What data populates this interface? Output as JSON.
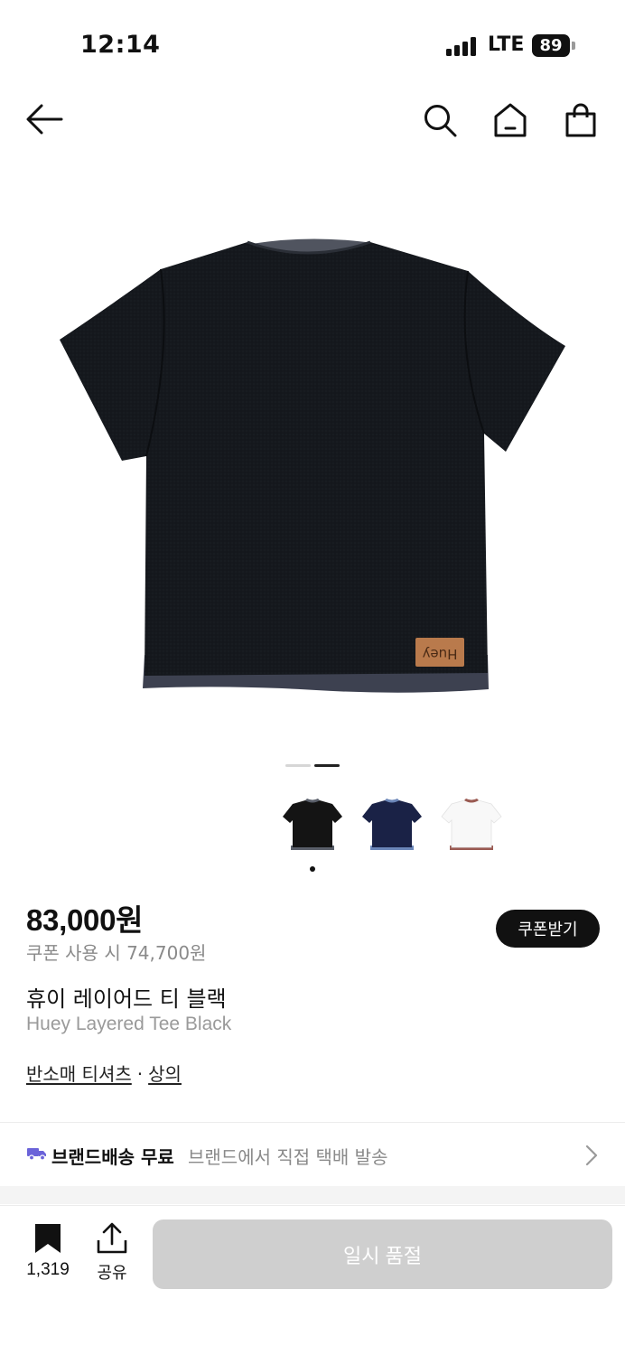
{
  "status_bar": {
    "time": "12:14",
    "network": "LTE",
    "battery": "89"
  },
  "nav": {
    "icons": [
      "back-arrow-icon",
      "search-icon",
      "home-icon",
      "shopping-bag-icon"
    ]
  },
  "gallery": {
    "slide_count": 2,
    "current_slide": 2,
    "thumbnails": [
      {
        "color_name": "black",
        "body": "#141414",
        "collar": "#5a5f6a"
      },
      {
        "color_name": "navy",
        "body": "#1a2246",
        "collar": "#6b86b8"
      },
      {
        "color_name": "white",
        "body": "#f8f8f8",
        "collar": "#9a5a52"
      }
    ],
    "selected_thumbnail": 0
  },
  "product": {
    "price": "83,000원",
    "coupon_price": "쿠폰 사용 시 74,700원",
    "coupon_button": "쿠폰받기",
    "name_ko": "휴이 레이어드 티 블랙",
    "name_en": "Huey Layered Tee Black",
    "categories": [
      "반소매 티셔츠",
      "상의"
    ],
    "category_separator": "·"
  },
  "shipping": {
    "main": "브랜드배송 무료",
    "sub": "브랜드에서 직접 택배 발송"
  },
  "bottom_bar": {
    "bookmark_count": "1,319",
    "share_label": "공유",
    "soldout_label": "일시 품절"
  },
  "colors": {
    "accent_truck": "#6b63d9",
    "disabled_button": "#cfcfcf"
  }
}
